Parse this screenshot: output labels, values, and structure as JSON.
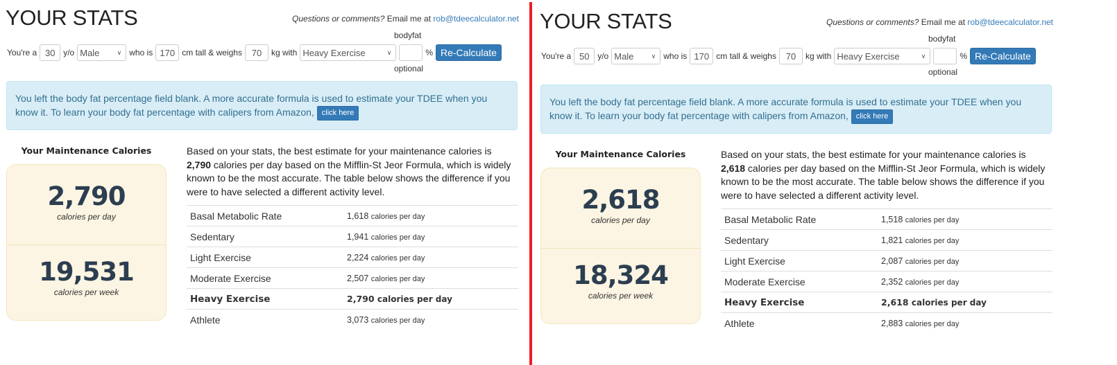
{
  "divider_color": "#ed1c24",
  "panels": [
    {
      "title": "YOUR STATS",
      "contact_prefix": "Questions or comments?",
      "contact_mid": " Email me at ",
      "contact_email": "rob@tdeecalculator.net",
      "form": {
        "youre_a": "You're a",
        "age": "30",
        "yo": "y/o",
        "gender": "Male",
        "who_is": "who is",
        "height": "170",
        "cm_tall": "cm tall & weighs",
        "weight": "70",
        "kg_with": "kg with",
        "activity": "Heavy Exercise",
        "bodyfat": "",
        "bodyfat_label": "bodyfat",
        "percent": "%",
        "optional": "optional",
        "button": "Re-Calculate"
      },
      "alert": {
        "text": "You left the body fat percentage field blank. A more accurate formula is used to estimate your TDEE when you know it. To learn your body fat percentage with calipers from Amazon, ",
        "button": "click here"
      },
      "maintenance_heading": "Your Maintenance Calories",
      "per_day": "2,790",
      "per_day_unit": "calories per day",
      "per_week": "19,531",
      "per_week_unit": "calories per week",
      "desc_before": "Based on your stats, the best estimate for your maintenance calories is ",
      "desc_value": "2,790",
      "desc_after": " calories per day based on the Mifflin-St Jeor Formula, which is widely known to be the most accurate. The table below shows the difference if you were to have selected a different activity level.",
      "table": [
        {
          "label": "Basal Metabolic Rate",
          "value": "1,618",
          "unit": "calories per day"
        },
        {
          "label": "Sedentary",
          "value": "1,941",
          "unit": "calories per day"
        },
        {
          "label": "Light Exercise",
          "value": "2,224",
          "unit": "calories per day"
        },
        {
          "label": "Moderate Exercise",
          "value": "2,507",
          "unit": "calories per day"
        },
        {
          "label": "Heavy Exercise",
          "value": "2,790",
          "unit": "calories per day",
          "selected": true
        },
        {
          "label": "Athlete",
          "value": "3,073",
          "unit": "calories per day"
        }
      ]
    },
    {
      "title": "YOUR STATS",
      "contact_prefix": "Questions or comments?",
      "contact_mid": " Email me at ",
      "contact_email": "rob@tdeecalculator.net",
      "form": {
        "youre_a": "You're a",
        "age": "50",
        "yo": "y/o",
        "gender": "Male",
        "who_is": "who is",
        "height": "170",
        "cm_tall": "cm tall & weighs",
        "weight": "70",
        "kg_with": "kg with",
        "activity": "Heavy Exercise",
        "bodyfat": "",
        "bodyfat_label": "bodyfat",
        "percent": "%",
        "optional": "optional",
        "button": "Re-Calculate"
      },
      "alert": {
        "text": "You left the body fat percentage field blank. A more accurate formula is used to estimate your TDEE when you know it. To learn your body fat percentage with calipers from Amazon, ",
        "button": "click here"
      },
      "maintenance_heading": "Your Maintenance Calories",
      "per_day": "2,618",
      "per_day_unit": "calories per day",
      "per_week": "18,324",
      "per_week_unit": "calories per week",
      "desc_before": "Based on your stats, the best estimate for your maintenance calories is ",
      "desc_value": "2,618",
      "desc_after": " calories per day based on the Mifflin-St Jeor Formula, which is widely known to be the most accurate. The table below shows the difference if you were to have selected a different activity level.",
      "table": [
        {
          "label": "Basal Metabolic Rate",
          "value": "1,518",
          "unit": "calories per day"
        },
        {
          "label": "Sedentary",
          "value": "1,821",
          "unit": "calories per day"
        },
        {
          "label": "Light Exercise",
          "value": "2,087",
          "unit": "calories per day"
        },
        {
          "label": "Moderate Exercise",
          "value": "2,352",
          "unit": "calories per day"
        },
        {
          "label": "Heavy Exercise",
          "value": "2,618",
          "unit": "calories per day",
          "selected": true
        },
        {
          "label": "Athlete",
          "value": "2,883",
          "unit": "calories per day"
        }
      ]
    }
  ]
}
